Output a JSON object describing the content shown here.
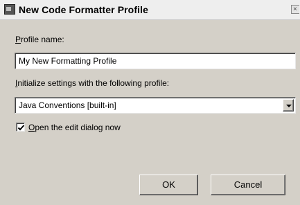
{
  "window": {
    "title": "New Code Formatter Profile"
  },
  "profile_name": {
    "label_mnemonic": "P",
    "label_rest": "rofile name:",
    "value": "My New Formatting Profile"
  },
  "init_settings": {
    "label_mnemonic": "I",
    "label_rest": "nitialize settings with the following profile:",
    "selected": "Java Conventions [built-in]"
  },
  "open_edit": {
    "checked": true,
    "label_mnemonic": "O",
    "label_rest": "pen the edit dialog now"
  },
  "buttons": {
    "ok": "OK",
    "cancel": "Cancel"
  }
}
